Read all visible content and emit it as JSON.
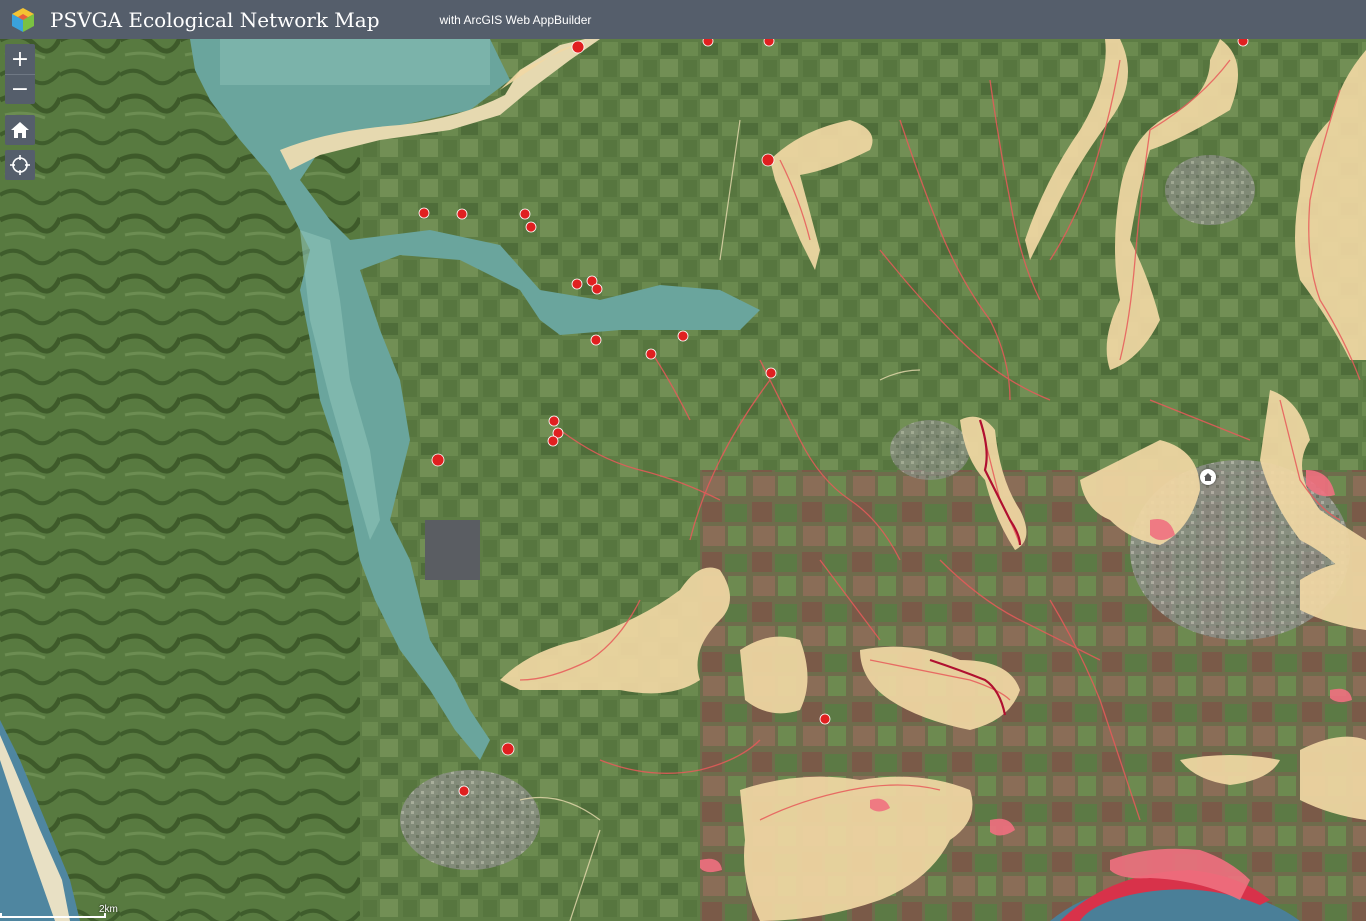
{
  "app": {
    "title": "PSVGA Ecological Network Map",
    "subtitle": "with ArcGIS Web AppBuilder"
  },
  "controls": {
    "zoom_in_label": "+",
    "zoom_out_label": "−",
    "home_icon": "home-icon",
    "locate_icon": "locate-icon"
  },
  "scalebar": {
    "label": "2km"
  },
  "legend_colors": {
    "water": "#6fa8a0",
    "farmland": "#5f7c47",
    "corridor_zone": "#f3d9a6",
    "stream": "#e85a5a",
    "point": "#e02020",
    "header": "#555e6b"
  },
  "map_points_count_note": ""
}
